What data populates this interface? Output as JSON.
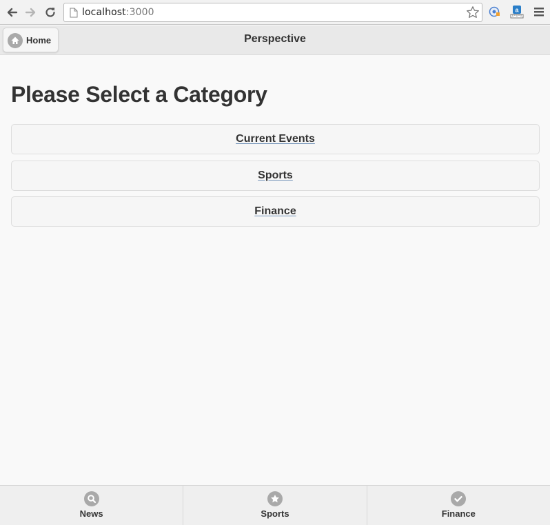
{
  "browser": {
    "url_host": "localhost",
    "url_port": ":3000"
  },
  "header": {
    "home_label": "Home",
    "title": "Perspective"
  },
  "main": {
    "heading": "Please Select a Category",
    "categories": [
      {
        "label": "Current Events"
      },
      {
        "label": "Sports"
      },
      {
        "label": "Finance"
      }
    ]
  },
  "footer": {
    "tabs": [
      {
        "label": "News",
        "icon": "search-icon"
      },
      {
        "label": "Sports",
        "icon": "star-icon"
      },
      {
        "label": "Finance",
        "icon": "check-icon"
      }
    ]
  },
  "colors": {
    "background": "#f9f9f9",
    "header": "#e9e9e9",
    "icon_gray": "#a9a9a9",
    "text": "#333333",
    "link_underline": "#6e8fb6"
  }
}
